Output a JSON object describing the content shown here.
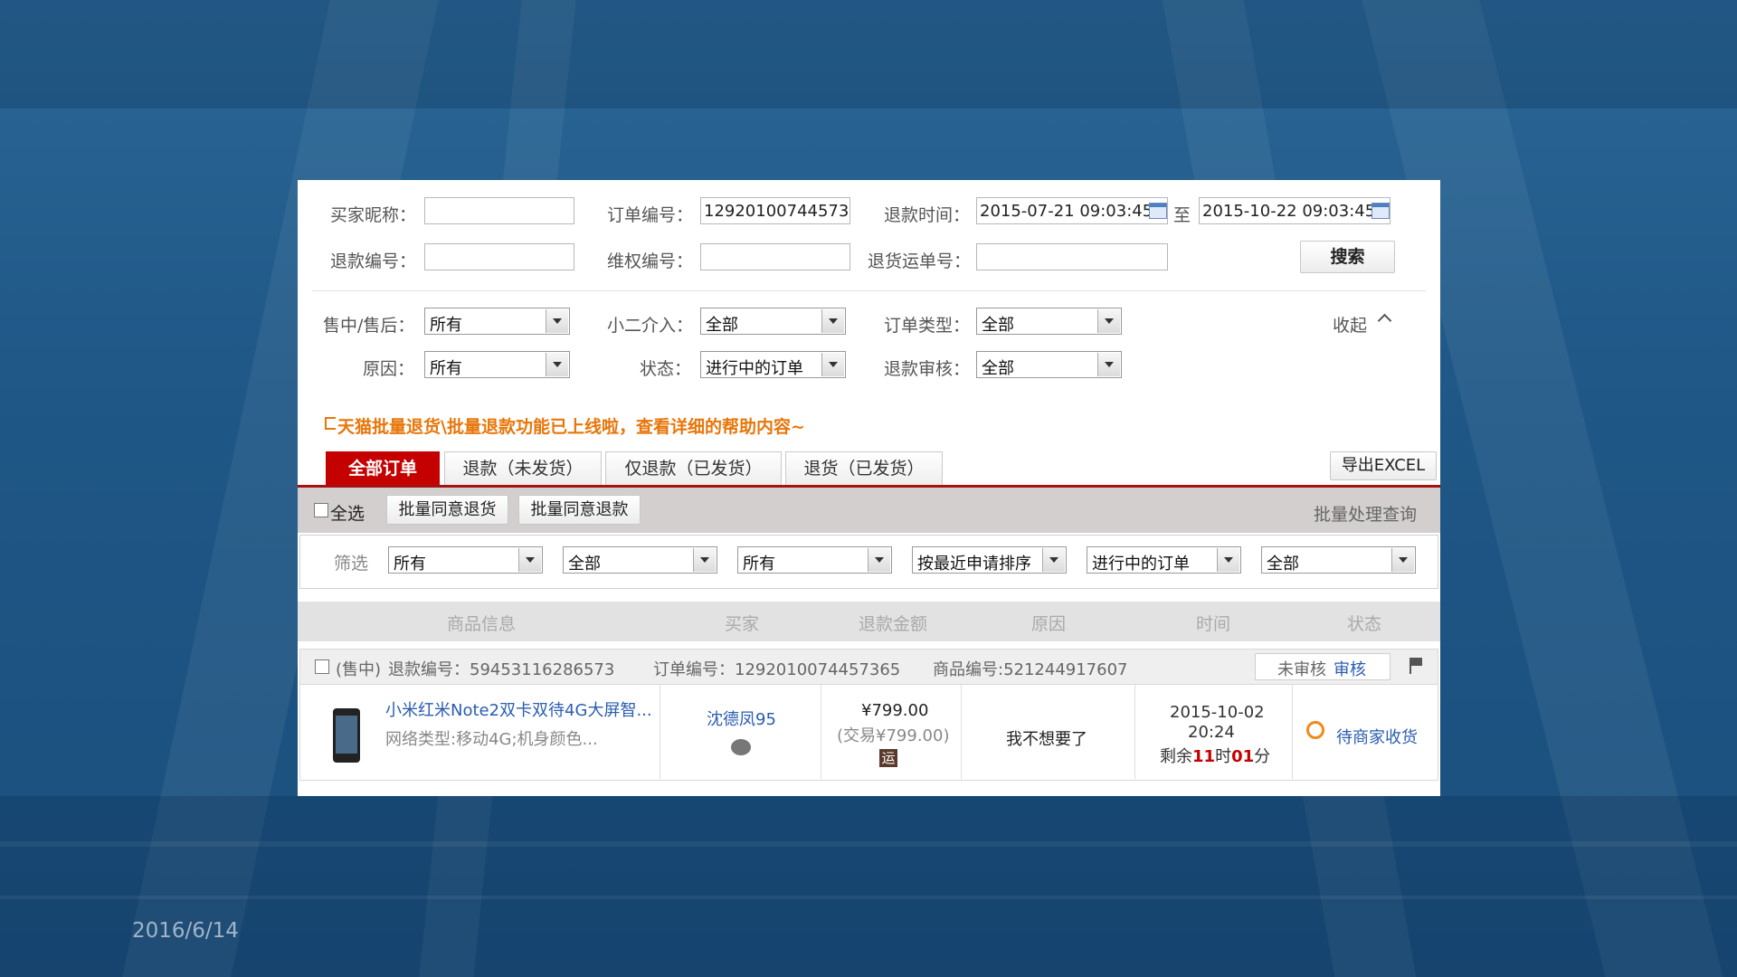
{
  "slide": {
    "date": "2016/6/14"
  },
  "search": {
    "buyer_label": "买家昵称：",
    "buyer_value": "",
    "order_no_label": "订单编号：",
    "order_no_value": "1292010074457365",
    "refund_time_label": "退款时间：",
    "refund_time_from": "2015-07-21 09:03:45",
    "to_label": "至",
    "refund_time_to": "2015-10-22 09:03:45",
    "refund_no_label": "退款编号：",
    "refund_no_value": "",
    "rights_no_label": "维权编号：",
    "rights_no_value": "",
    "return_waybill_label": "退货运单号：",
    "return_waybill_value": "",
    "search_button": "搜索"
  },
  "filters": {
    "sale_phase_label": "售中/售后：",
    "sale_phase_value": "所有",
    "xiaoer_label": "小二介入：",
    "xiaoer_value": "全部",
    "order_type_label": "订单类型：",
    "order_type_value": "全部",
    "collapse_label": "收起",
    "reason_label": "原因：",
    "reason_value": "所有",
    "status_label": "状态：",
    "status_value": "进行中的订单",
    "refund_review_label": "退款审核：",
    "refund_review_value": "全部"
  },
  "notice": "天猫批量退货\\批量退款功能已上线啦，查看详细的帮助内容~",
  "tabs": [
    {
      "label": "全部订单",
      "active": true
    },
    {
      "label": "退款（未发货）",
      "active": false
    },
    {
      "label": "仅退款（已发货）",
      "active": false
    },
    {
      "label": "退货（已发货）",
      "active": false
    }
  ],
  "export_button": "导出EXCEL",
  "batch": {
    "select_all": "全选",
    "agree_return": "批量同意退货",
    "agree_refund": "批量同意退款",
    "query": "批量处理查询"
  },
  "filter_row": {
    "label": "筛选",
    "selects": [
      "所有",
      "全部",
      "所有",
      "按最近申请排序",
      "进行中的订单",
      "全部"
    ]
  },
  "table": {
    "headers": [
      "商品信息",
      "买家",
      "退款金额",
      "原因",
      "时间",
      "状态"
    ],
    "rows": [
      {
        "phase": "(售中)",
        "refund_no": "退款编号：59453116286573",
        "order_no": "订单编号：1292010074457365",
        "item_no": "商品编号:521244917607",
        "review_status": "未审核",
        "review_link": "审核",
        "product_title": "小米红米Note2双卡双待4G大屏智...",
        "product_spec": "网络类型:移动4G;机身颜色...",
        "buyer": "沈德凤95",
        "amount": "¥799.00",
        "trade_amount": "(交易¥799.00)",
        "shipping_badge": "运",
        "reason": "我不想要了",
        "date": "2015-10-02",
        "time": "20:24",
        "remaining_prefix": "剩余",
        "remaining_hours": "11",
        "hours_unit": "时",
        "remaining_minutes": "01",
        "minutes_unit": "分",
        "status": "待商家收货"
      }
    ]
  },
  "colors": {
    "brand_red": "#c40000",
    "notice_orange": "#e8760a",
    "link_blue": "#2a5db0",
    "slide_blue": "#1f5a8a"
  }
}
